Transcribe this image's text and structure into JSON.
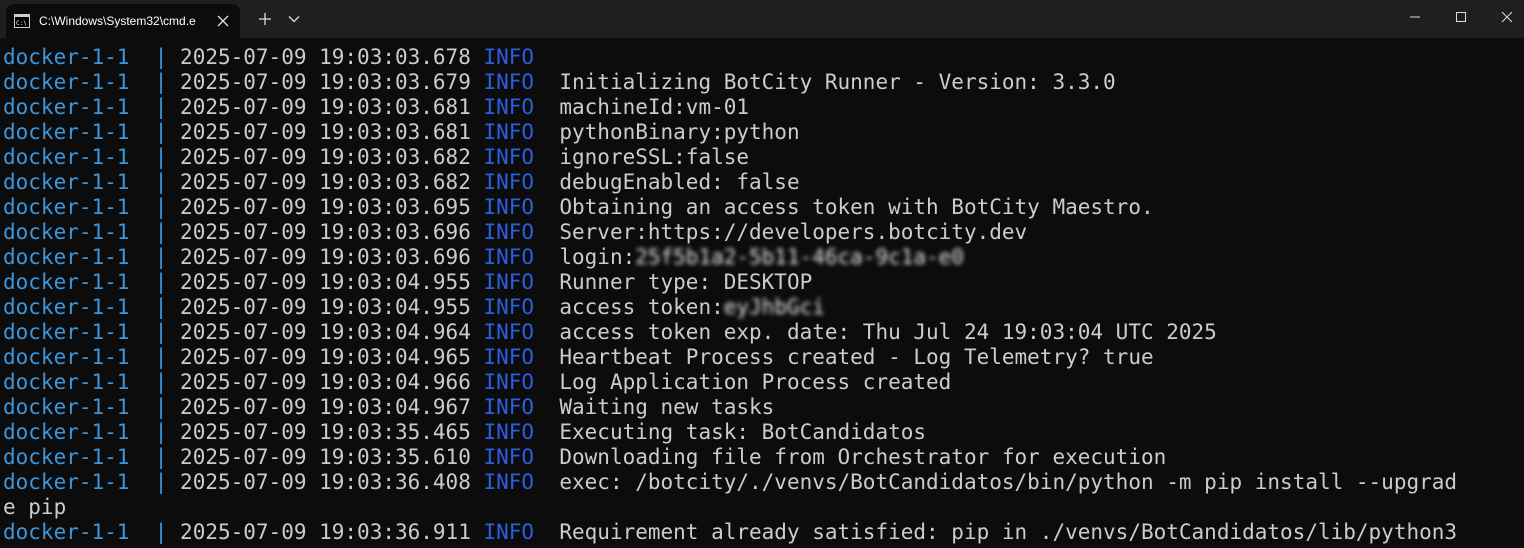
{
  "window": {
    "tab_title": "C:\\Windows\\System32\\cmd.e",
    "icons": {
      "tab": "terminal-icon",
      "close_tab": "close-icon",
      "new_tab": "plus-icon",
      "dropdown": "chevron-down-icon",
      "minimize": "minimize-icon",
      "maximize": "maximize-icon",
      "close": "close-icon"
    }
  },
  "colors": {
    "background": "#0c0c0c",
    "service": "#3a96dd",
    "level": "#2a5fe0",
    "text": "#cccccc"
  },
  "log": {
    "lines": [
      {
        "svc": "docker-1-1",
        "pipe": "|",
        "ts": "2025-07-09 19:03:03.678",
        "lvl": "INFO",
        "msg": ""
      },
      {
        "svc": "docker-1-1",
        "pipe": "|",
        "ts": "2025-07-09 19:03:03.679",
        "lvl": "INFO",
        "msg": "Initializing BotCity Runner - Version: 3.3.0"
      },
      {
        "svc": "docker-1-1",
        "pipe": "|",
        "ts": "2025-07-09 19:03:03.681",
        "lvl": "INFO",
        "msg": "machineId:vm-01"
      },
      {
        "svc": "docker-1-1",
        "pipe": "|",
        "ts": "2025-07-09 19:03:03.681",
        "lvl": "INFO",
        "msg": "pythonBinary:python"
      },
      {
        "svc": "docker-1-1",
        "pipe": "|",
        "ts": "2025-07-09 19:03:03.682",
        "lvl": "INFO",
        "msg": "ignoreSSL:false"
      },
      {
        "svc": "docker-1-1",
        "pipe": "|",
        "ts": "2025-07-09 19:03:03.682",
        "lvl": "INFO",
        "msg": "debugEnabled: false"
      },
      {
        "svc": "docker-1-1",
        "pipe": "|",
        "ts": "2025-07-09 19:03:03.695",
        "lvl": "INFO",
        "msg": "Obtaining an access token with BotCity Maestro."
      },
      {
        "svc": "docker-1-1",
        "pipe": "|",
        "ts": "2025-07-09 19:03:03.696",
        "lvl": "INFO",
        "msg": "Server:https://developers.botcity.dev"
      },
      {
        "svc": "docker-1-1",
        "pipe": "|",
        "ts": "2025-07-09 19:03:03.696",
        "lvl": "INFO",
        "msg": "login:",
        "blurred": "25f5b1a2-5b11-46ca-9c1a-e0"
      },
      {
        "svc": "docker-1-1",
        "pipe": "|",
        "ts": "2025-07-09 19:03:04.955",
        "lvl": "INFO",
        "msg": "Runner type: DESKTOP"
      },
      {
        "svc": "docker-1-1",
        "pipe": "|",
        "ts": "2025-07-09 19:03:04.955",
        "lvl": "INFO",
        "msg": "access token:",
        "blurred": "eyJhbGci"
      },
      {
        "svc": "docker-1-1",
        "pipe": "|",
        "ts": "2025-07-09 19:03:04.964",
        "lvl": "INFO",
        "msg": "access token exp. date: Thu Jul 24 19:03:04 UTC 2025"
      },
      {
        "svc": "docker-1-1",
        "pipe": "|",
        "ts": "2025-07-09 19:03:04.965",
        "lvl": "INFO",
        "msg": "Heartbeat Process created - Log Telemetry? true"
      },
      {
        "svc": "docker-1-1",
        "pipe": "|",
        "ts": "2025-07-09 19:03:04.966",
        "lvl": "INFO",
        "msg": "Log Application Process created"
      },
      {
        "svc": "docker-1-1",
        "pipe": "|",
        "ts": "2025-07-09 19:03:04.967",
        "lvl": "INFO",
        "msg": "Waiting new tasks"
      },
      {
        "svc": "docker-1-1",
        "pipe": "|",
        "ts": "2025-07-09 19:03:35.465",
        "lvl": "INFO",
        "msg": "Executing task: BotCandidatos"
      },
      {
        "svc": "docker-1-1",
        "pipe": "|",
        "ts": "2025-07-09 19:03:35.610",
        "lvl": "INFO",
        "msg": "Downloading file from Orchestrator for execution"
      },
      {
        "svc": "docker-1-1",
        "pipe": "|",
        "ts": "2025-07-09 19:03:36.408",
        "lvl": "INFO",
        "msg": "exec: /botcity/./venvs/BotCandidatos/bin/python -m pip install --upgrad"
      },
      {
        "plain": "e pip"
      },
      {
        "svc": "docker-1-1",
        "pipe": "|",
        "ts": "2025-07-09 19:03:36.911",
        "lvl": "INFO",
        "msg": "Requirement already satisfied: pip in ./venvs/BotCandidatos/lib/python3"
      }
    ]
  }
}
